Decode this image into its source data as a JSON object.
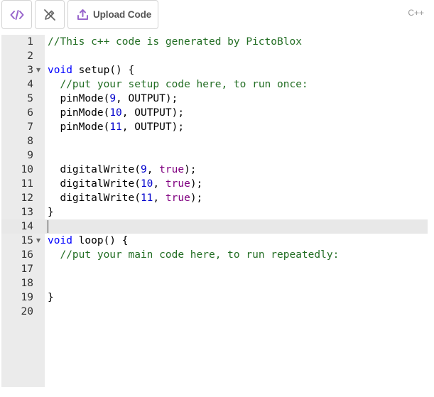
{
  "toolbar": {
    "code_icon": "code-brackets-icon",
    "edit_icon": "pencil-slash-icon",
    "upload_icon": "upload-icon",
    "upload_label": "Upload Code",
    "language": "C++"
  },
  "colors": {
    "comment": "#236e24",
    "keyword": "#0000ff",
    "number": "#0000cd",
    "boolean": "#800080",
    "gutter": "#ebebeb",
    "accent": "#9966cc"
  },
  "editor": {
    "active_line": 14,
    "lines": [
      {
        "num": "1",
        "tokens": [
          {
            "t": "comment",
            "v": "//This c++ code is generated by PictoBlox"
          }
        ]
      },
      {
        "num": "2",
        "tokens": []
      },
      {
        "num": "3",
        "fold": true,
        "tokens": [
          {
            "t": "keyword",
            "v": "void"
          },
          {
            "t": "plain",
            "v": " setup() {"
          }
        ]
      },
      {
        "num": "4",
        "tokens": [
          {
            "t": "plain",
            "v": "  "
          },
          {
            "t": "comment",
            "v": "//put your setup code here, to run once:"
          }
        ]
      },
      {
        "num": "5",
        "tokens": [
          {
            "t": "plain",
            "v": "  pinMode("
          },
          {
            "t": "number",
            "v": "9"
          },
          {
            "t": "plain",
            "v": ", OUTPUT);"
          }
        ]
      },
      {
        "num": "6",
        "tokens": [
          {
            "t": "plain",
            "v": "  pinMode("
          },
          {
            "t": "number",
            "v": "10"
          },
          {
            "t": "plain",
            "v": ", OUTPUT);"
          }
        ]
      },
      {
        "num": "7",
        "tokens": [
          {
            "t": "plain",
            "v": "  pinMode("
          },
          {
            "t": "number",
            "v": "11"
          },
          {
            "t": "plain",
            "v": ", OUTPUT);"
          }
        ]
      },
      {
        "num": "8",
        "tokens": []
      },
      {
        "num": "9",
        "tokens": []
      },
      {
        "num": "10",
        "tokens": [
          {
            "t": "plain",
            "v": "  digitalWrite("
          },
          {
            "t": "number",
            "v": "9"
          },
          {
            "t": "plain",
            "v": ", "
          },
          {
            "t": "bool",
            "v": "true"
          },
          {
            "t": "plain",
            "v": ");"
          }
        ]
      },
      {
        "num": "11",
        "tokens": [
          {
            "t": "plain",
            "v": "  digitalWrite("
          },
          {
            "t": "number",
            "v": "10"
          },
          {
            "t": "plain",
            "v": ", "
          },
          {
            "t": "bool",
            "v": "true"
          },
          {
            "t": "plain",
            "v": ");"
          }
        ]
      },
      {
        "num": "12",
        "tokens": [
          {
            "t": "plain",
            "v": "  digitalWrite("
          },
          {
            "t": "number",
            "v": "11"
          },
          {
            "t": "plain",
            "v": ", "
          },
          {
            "t": "bool",
            "v": "true"
          },
          {
            "t": "plain",
            "v": ");"
          }
        ]
      },
      {
        "num": "13",
        "tokens": [
          {
            "t": "plain",
            "v": "}"
          }
        ]
      },
      {
        "num": "14",
        "tokens": []
      },
      {
        "num": "15",
        "fold": true,
        "tokens": [
          {
            "t": "keyword",
            "v": "void"
          },
          {
            "t": "plain",
            "v": " loop() {"
          }
        ]
      },
      {
        "num": "16",
        "tokens": [
          {
            "t": "plain",
            "v": "  "
          },
          {
            "t": "comment",
            "v": "//put your main code here, to run repeatedly:"
          }
        ]
      },
      {
        "num": "17",
        "tokens": []
      },
      {
        "num": "18",
        "tokens": []
      },
      {
        "num": "19",
        "tokens": [
          {
            "t": "plain",
            "v": "}"
          }
        ]
      },
      {
        "num": "20",
        "tokens": []
      }
    ]
  }
}
